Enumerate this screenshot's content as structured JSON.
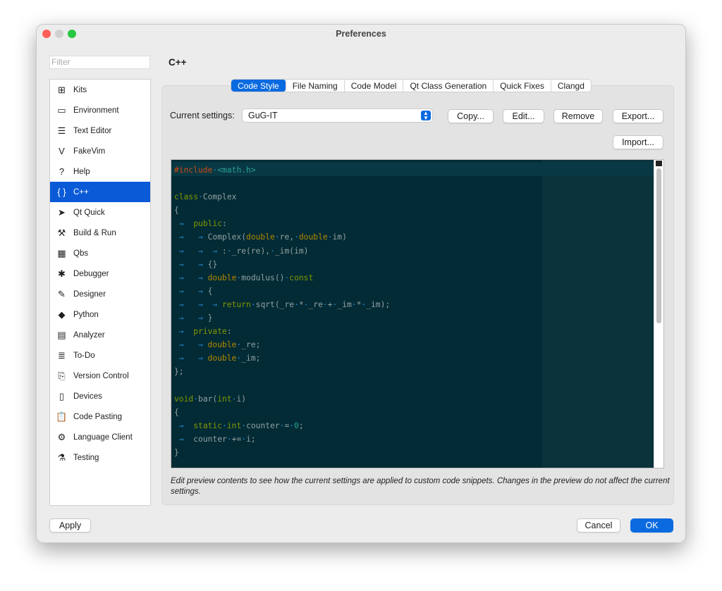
{
  "window": {
    "title": "Preferences"
  },
  "filter": {
    "placeholder": "Filter"
  },
  "sidebar": {
    "items": [
      {
        "label": "Kits",
        "icon": "kits-icon",
        "glyph": "⊞"
      },
      {
        "label": "Environment",
        "icon": "monitor-icon",
        "glyph": "▭"
      },
      {
        "label": "Text Editor",
        "icon": "text-editor-icon",
        "glyph": "☰"
      },
      {
        "label": "FakeVim",
        "icon": "fakevim-icon",
        "glyph": "V"
      },
      {
        "label": "Help",
        "icon": "help-icon",
        "glyph": "?"
      },
      {
        "label": "C++",
        "icon": "braces-icon",
        "glyph": "{ }",
        "selected": true
      },
      {
        "label": "Qt Quick",
        "icon": "qtquick-icon",
        "glyph": "➤"
      },
      {
        "label": "Build & Run",
        "icon": "hammer-icon",
        "glyph": "⚒"
      },
      {
        "label": "Qbs",
        "icon": "qbs-icon",
        "glyph": "▦"
      },
      {
        "label": "Debugger",
        "icon": "bug-icon",
        "glyph": "✱"
      },
      {
        "label": "Designer",
        "icon": "pen-icon",
        "glyph": "✎"
      },
      {
        "label": "Python",
        "icon": "python-icon",
        "glyph": "◆"
      },
      {
        "label": "Analyzer",
        "icon": "analyzer-icon",
        "glyph": "▤"
      },
      {
        "label": "To-Do",
        "icon": "todo-list-icon",
        "glyph": "≣"
      },
      {
        "label": "Version Control",
        "icon": "version-control-icon",
        "glyph": "⎘"
      },
      {
        "label": "Devices",
        "icon": "devices-icon",
        "glyph": "▯"
      },
      {
        "label": "Code Pasting",
        "icon": "clipboard-icon",
        "glyph": "📋"
      },
      {
        "label": "Language Client",
        "icon": "language-client-icon",
        "glyph": "⚙"
      },
      {
        "label": "Testing",
        "icon": "flask-icon",
        "glyph": "⚗"
      }
    ]
  },
  "page": {
    "title": "C++"
  },
  "tabs": [
    {
      "label": "Code Style",
      "active": true
    },
    {
      "label": "File Naming"
    },
    {
      "label": "Code Model"
    },
    {
      "label": "Qt Class Generation"
    },
    {
      "label": "Quick Fixes"
    },
    {
      "label": "Clangd"
    }
  ],
  "settings": {
    "label": "Current settings:",
    "value": "GuG-IT",
    "copy": "Copy...",
    "edit": "Edit...",
    "remove": "Remove",
    "export": "Export...",
    "import": "Import..."
  },
  "colors": {
    "kw": "#859900",
    "type": "#b58900",
    "text": "#93a1a1",
    "pre": "#cb4b16",
    "inc": "#2aa198",
    "ws": "#268bd2",
    "num": "#2aa198",
    "accent": "#0a6ae0"
  },
  "code": [
    [
      [
        "pre",
        "#include"
      ],
      [
        "ws",
        "·"
      ],
      [
        "inc",
        "<math.h>"
      ]
    ],
    [],
    [
      [
        "kw",
        "class"
      ],
      [
        "ws",
        "·"
      ],
      [
        "text",
        "Complex"
      ]
    ],
    [
      [
        "text",
        "{"
      ]
    ],
    [
      [
        "ws",
        " →  "
      ],
      [
        "kw",
        "public"
      ],
      [
        "text",
        ":"
      ]
    ],
    [
      [
        "ws",
        " →   → "
      ],
      [
        "text",
        "Complex("
      ],
      [
        "type",
        "double"
      ],
      [
        "ws",
        "·"
      ],
      [
        "text",
        "re,"
      ],
      [
        "ws",
        "·"
      ],
      [
        "type",
        "double"
      ],
      [
        "ws",
        "·"
      ],
      [
        "text",
        "im)"
      ]
    ],
    [
      [
        "ws",
        " →   →  → "
      ],
      [
        "text",
        ":"
      ],
      [
        "ws",
        "·"
      ],
      [
        "text",
        "_re(re),"
      ],
      [
        "ws",
        "·"
      ],
      [
        "text",
        "_im(im)"
      ]
    ],
    [
      [
        "ws",
        " →   → "
      ],
      [
        "text",
        "{}"
      ]
    ],
    [
      [
        "ws",
        " →   → "
      ],
      [
        "type",
        "double"
      ],
      [
        "ws",
        "·"
      ],
      [
        "text",
        "modulus()"
      ],
      [
        "ws",
        "·"
      ],
      [
        "kw",
        "const"
      ]
    ],
    [
      [
        "ws",
        " →   → "
      ],
      [
        "text",
        "{"
      ]
    ],
    [
      [
        "ws",
        " →   →  → "
      ],
      [
        "kw",
        "return"
      ],
      [
        "ws",
        "·"
      ],
      [
        "text",
        "sqrt(_re"
      ],
      [
        "ws",
        "·"
      ],
      [
        "text",
        "*"
      ],
      [
        "ws",
        "·"
      ],
      [
        "text",
        "_re"
      ],
      [
        "ws",
        "·"
      ],
      [
        "text",
        "+"
      ],
      [
        "ws",
        "·"
      ],
      [
        "text",
        "_im"
      ],
      [
        "ws",
        "·"
      ],
      [
        "text",
        "*"
      ],
      [
        "ws",
        "·"
      ],
      [
        "text",
        "_im);"
      ]
    ],
    [
      [
        "ws",
        " →   → "
      ],
      [
        "text",
        "}"
      ]
    ],
    [
      [
        "ws",
        " →  "
      ],
      [
        "kw",
        "private"
      ],
      [
        "text",
        ":"
      ]
    ],
    [
      [
        "ws",
        " →   → "
      ],
      [
        "type",
        "double"
      ],
      [
        "ws",
        "·"
      ],
      [
        "text",
        "_re;"
      ]
    ],
    [
      [
        "ws",
        " →   → "
      ],
      [
        "type",
        "double"
      ],
      [
        "ws",
        "·"
      ],
      [
        "text",
        "_im;"
      ]
    ],
    [
      [
        "text",
        "};"
      ]
    ],
    [],
    [
      [
        "kw",
        "void"
      ],
      [
        "ws",
        "·"
      ],
      [
        "text",
        "bar("
      ],
      [
        "kw",
        "int"
      ],
      [
        "ws",
        "·"
      ],
      [
        "text",
        "i)"
      ]
    ],
    [
      [
        "text",
        "{"
      ]
    ],
    [
      [
        "ws",
        " →  "
      ],
      [
        "kw",
        "static"
      ],
      [
        "ws",
        "·"
      ],
      [
        "kw",
        "int"
      ],
      [
        "ws",
        "·"
      ],
      [
        "text",
        "counter"
      ],
      [
        "ws",
        "·"
      ],
      [
        "text",
        "="
      ],
      [
        "ws",
        "·"
      ],
      [
        "num",
        "0"
      ],
      [
        "text",
        ";"
      ]
    ],
    [
      [
        "ws",
        " →  "
      ],
      [
        "text",
        "counter"
      ],
      [
        "ws",
        "·"
      ],
      [
        "text",
        "+="
      ],
      [
        "ws",
        "·"
      ],
      [
        "text",
        "i;"
      ]
    ],
    [
      [
        "text",
        "}"
      ]
    ]
  ],
  "note": "Edit preview contents to see how the current settings are applied to custom code snippets. Changes in the preview do not affect the current settings.",
  "footer": {
    "apply": "Apply",
    "cancel": "Cancel",
    "ok": "OK"
  }
}
